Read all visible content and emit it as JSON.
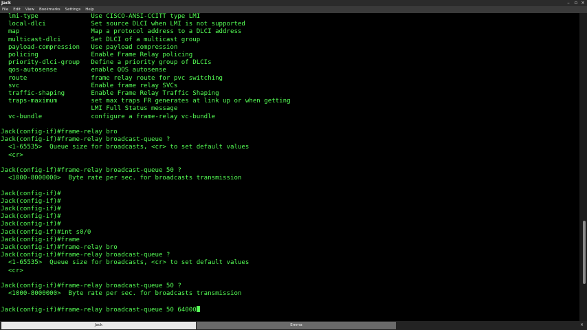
{
  "window": {
    "title": "Jack",
    "controls": [
      "–",
      "▫",
      "×"
    ]
  },
  "menu": [
    "File",
    "Edit",
    "View",
    "Bookmarks",
    "Settings",
    "Help"
  ],
  "terminal": {
    "lines": [
      "  lmi-type              Use CISCO-ANSI-CCITT type LMI",
      "  local-dlci            Set source DLCI when LMI is not supported",
      "  map                   Map a protocol address to a DLCI address",
      "  multicast-dlci        Set DLCI of a multicast group",
      "  payload-compression   Use payload compression",
      "  policing              Enable Frame Relay policing",
      "  priority-dlci-group   Define a priority group of DLCIs",
      "  qos-autosense         enable QOS autosense",
      "  route                 frame relay route for pvc switching",
      "  svc                   Enable frame relay SVCs",
      "  traffic-shaping       Enable Frame Relay Traffic Shaping",
      "  traps-maximum         set max traps FR generates at link up or when getting",
      "                        LMI Full Status message",
      "  vc-bundle             configure a frame-relay vc-bundle",
      "",
      "Jack(config-if)#frame-relay bro",
      "Jack(config-if)#frame-relay broadcast-queue ?",
      "  <1-65535>  Queue size for broadcasts, <cr> to set default values",
      "  <cr>",
      "",
      "Jack(config-if)#frame-relay broadcast-queue 50 ?",
      "  <1000-8000000>  Byte rate per sec. for broadcasts transmission",
      "",
      "Jack(config-if)#",
      "Jack(config-if)#",
      "Jack(config-if)#",
      "Jack(config-if)#",
      "Jack(config-if)#",
      "Jack(config-if)#int s0/0",
      "Jack(config-if)#frame",
      "Jack(config-if)#frame-relay bro",
      "Jack(config-if)#frame-relay broadcast-queue ?",
      "  <1-65535>  Queue size for broadcasts, <cr> to set default values",
      "  <cr>",
      "",
      "Jack(config-if)#frame-relay broadcast-queue 50 ?",
      "  <1000-8000000>  Byte rate per sec. for broadcasts transmission",
      "",
      "Jack(config-if)#frame-relay broadcast-queue 50 64000"
    ]
  },
  "tabs": [
    {
      "label": "Jack",
      "active": true
    },
    {
      "label": "Emma",
      "active": false
    }
  ],
  "colors": {
    "terminal_fg": "#55ff55",
    "terminal_bg": "#000000",
    "active_tab": "#e9e9e9",
    "inactive_tab": "#6a6a6a"
  }
}
